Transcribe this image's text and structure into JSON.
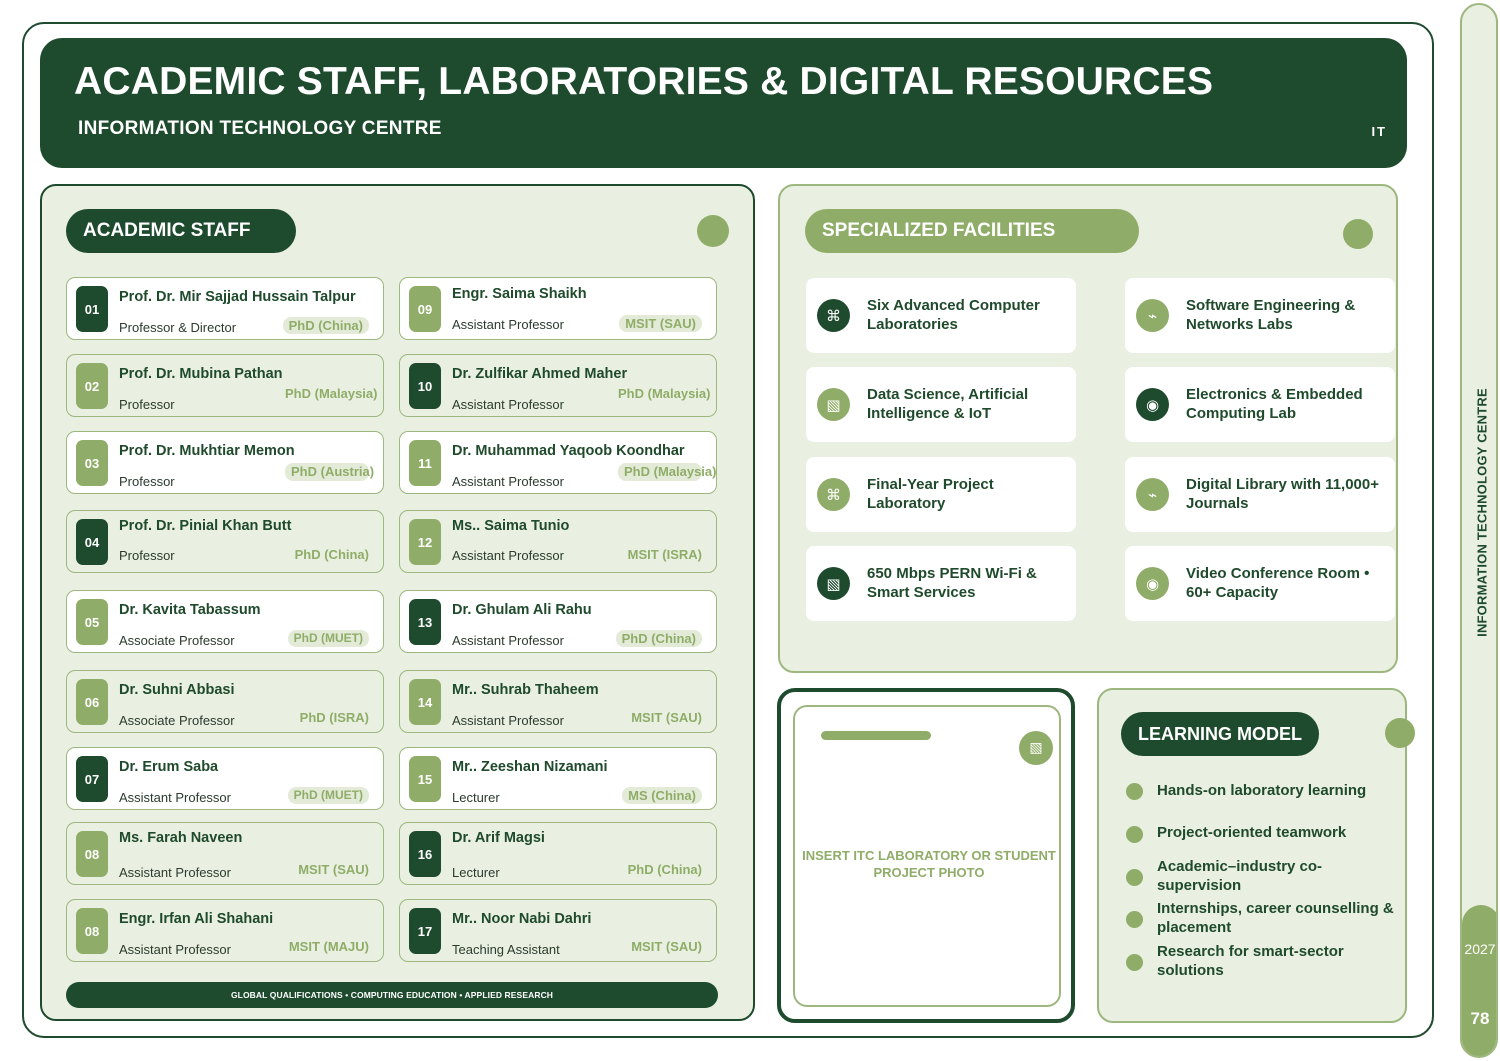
{
  "header": {
    "title": "ACADEMIC STAFF, LABORATORIES & DIGITAL RESOURCES",
    "subtitle": "INFORMATION TECHNOLOGY CENTRE",
    "code": "IT"
  },
  "staff": {
    "heading": "ACADEMIC STAFF",
    "left": [
      {
        "num": "01",
        "name": "Prof. Dr. Mir Sajjad Hussain Talpur",
        "role": "Professor & Director",
        "degree": "PhD (China)"
      },
      {
        "num": "02",
        "name": "Prof. Dr. Mubina Pathan",
        "role": "Professor",
        "degree": "PhD (Malaysia)"
      },
      {
        "num": "03",
        "name": "Prof. Dr. Mukhtiar Memon",
        "role": "Professor",
        "degree": "PhD (Austria)"
      },
      {
        "num": "04",
        "name": "Prof. Dr. Pinial Khan Butt",
        "role": "Professor",
        "degree": "PhD (China)"
      },
      {
        "num": "05",
        "name": "Dr. Kavita Tabassum",
        "role": "Associate Professor",
        "degree": "PhD (MUET)"
      },
      {
        "num": "06",
        "name": "Dr. Suhni Abbasi",
        "role": "Associate Professor",
        "degree": "PhD (ISRA)"
      },
      {
        "num": "07",
        "name": "Dr. Erum Saba",
        "role": "Assistant Professor",
        "degree": "PhD (MUET)"
      },
      {
        "num": "08",
        "name": "Ms. Farah Naveen",
        "role": "Assistant Professor",
        "degree": "MSIT (SAU)"
      },
      {
        "num": "08",
        "name": "Engr. Irfan Ali Shahani",
        "role": "Assistant Professor",
        "degree": "MSIT (MAJU)"
      }
    ],
    "right": [
      {
        "num": "09",
        "name": "Engr. Saima Shaikh",
        "role": "Assistant Professor",
        "degree": "MSIT (SAU)"
      },
      {
        "num": "10",
        "name": "Dr. Zulfikar Ahmed Maher",
        "role": "Assistant Professor",
        "degree": "PhD (Malaysia)"
      },
      {
        "num": "11",
        "name": "Dr. Muhammad Yaqoob Koondhar",
        "role": "Assistant Professor",
        "degree": "PhD (Malaysia)"
      },
      {
        "num": "12",
        "name": "Ms.. Saima Tunio",
        "role": "Assistant Professor",
        "degree": "MSIT (ISRA)"
      },
      {
        "num": "13",
        "name": "Dr. Ghulam Ali Rahu",
        "role": "Assistant Professor",
        "degree": "PhD (China)"
      },
      {
        "num": "14",
        "name": "Mr.. Suhrab Thaheem",
        "role": "Assistant Professor",
        "degree": "MSIT (SAU)"
      },
      {
        "num": "15",
        "name": "Mr.. Zeeshan Nizamani",
        "role": "Lecturer",
        "degree": "MS (China)"
      },
      {
        "num": "16",
        "name": "Dr. Arif Magsi",
        "role": "Lecturer",
        "degree": "PhD (China)"
      },
      {
        "num": "17",
        "name": "Mr.. Noor Nabi Dahri",
        "role": "Teaching Assistant",
        "degree": "MSIT (SAU)"
      }
    ],
    "footer": "GLOBAL QUALIFICATIONS • COMPUTING EDUCATION • APPLIED RESEARCH"
  },
  "facilities": {
    "heading": "SPECIALIZED FACILITIES",
    "items": [
      {
        "label": "Six Advanced Computer Laboratories",
        "icon": "command-icon",
        "glyph": "⌘"
      },
      {
        "label": "Software Engineering & Networks Labs",
        "icon": "leaf-icon",
        "glyph": "⌁"
      },
      {
        "label": "Data Science, Artificial Intelligence & IoT",
        "icon": "grid-icon",
        "glyph": "▧"
      },
      {
        "label": "Electronics & Embedded Computing Lab",
        "icon": "target-icon",
        "glyph": "◉"
      },
      {
        "label": "Final-Year Project Laboratory",
        "icon": "command-icon",
        "glyph": "⌘"
      },
      {
        "label": "Digital Library with 11,000+ Journals",
        "icon": "leaf-icon",
        "glyph": "⌁"
      },
      {
        "label": "650 Mbps PERN Wi-Fi & Smart Services",
        "icon": "grid-icon",
        "glyph": "▧"
      },
      {
        "label": "Video Conference Room • 60+ Capacity",
        "icon": "target-icon",
        "glyph": "◉"
      }
    ]
  },
  "photo": {
    "placeholder": "INSERT ITC LABORATORY OR STUDENT PROJECT PHOTO",
    "icon_glyph": "▧"
  },
  "learning": {
    "heading": "LEARNING MODEL",
    "items": [
      "Hands-on laboratory learning",
      "Project-oriented teamwork",
      "Academic–industry co-supervision",
      "Internships, career counselling & placement",
      "Research for smart-sector solutions"
    ]
  },
  "side": {
    "label": "INFORMATION TECHNOLOGY CENTRE",
    "year": "2027",
    "page": "78"
  },
  "colors": {
    "dark_green": "#1e4a2d",
    "light_green": "#8fad68",
    "panel_bg": "#e9f0e1"
  }
}
